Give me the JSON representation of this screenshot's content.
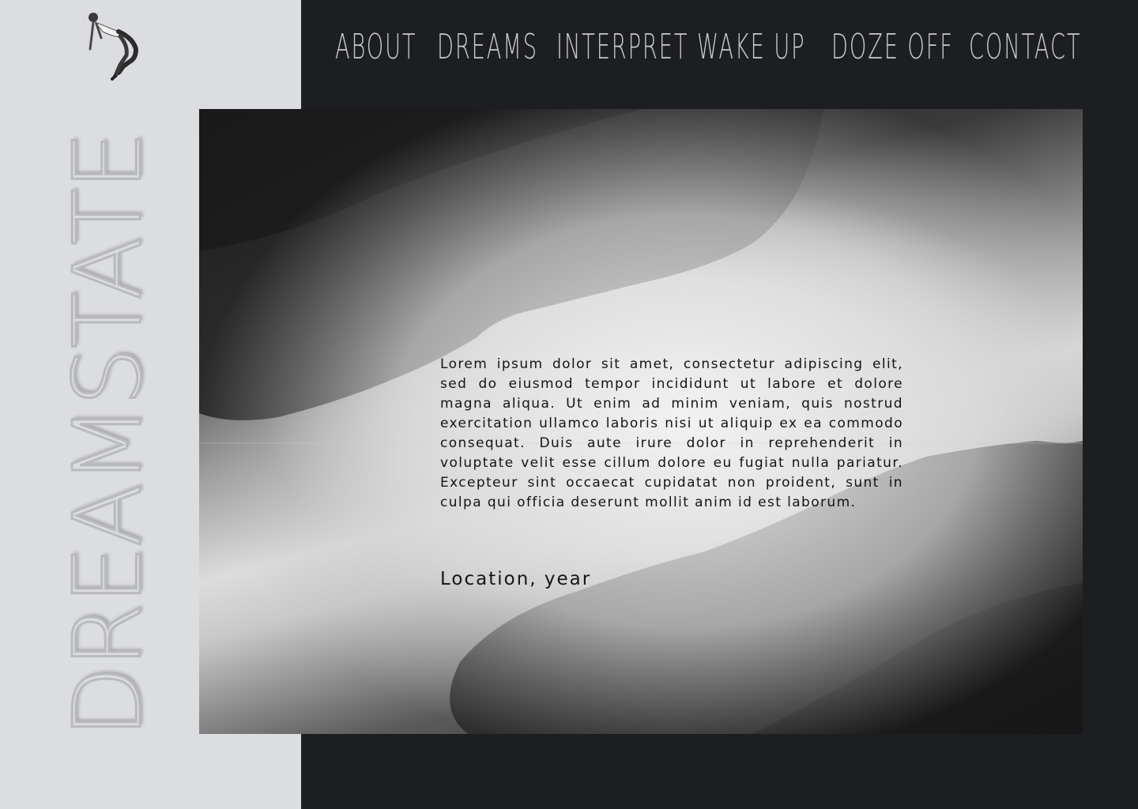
{
  "brand": {
    "name": "DREAMSTATE",
    "icon": "falling-person-icon"
  },
  "nav": {
    "items": [
      {
        "label": "ABOUT"
      },
      {
        "label": "DREAMS"
      },
      {
        "label": "INTERPRET"
      },
      {
        "label": "WAKE UP"
      },
      {
        "label": "DOZE OFF"
      },
      {
        "label": "CONTACT"
      }
    ]
  },
  "hero": {
    "image": "misty-forest-mirrored-image",
    "body": "Lorem ipsum dolor sit amet, consectetur adipiscing elit, sed do eiusmod tempor incididunt ut labore et dolore magna aliqua. Ut enim ad minim veniam, quis nostrud exercitation ullamco laboris nisi ut aliquip ex ea commodo consequat. Duis aute irure dolor in reprehenderit in voluptate velit esse cillum dolore eu fugiat nulla pariatur. Excepteur sint occaecat cupidatat non proident, sunt in culpa qui officia deserunt mollit anim id est laborum.",
    "caption": "Location, year"
  },
  "colors": {
    "background": "#1d1e21",
    "panel": "#dcdde0",
    "nav_text": "#c9cacd",
    "body_text": "#141414"
  }
}
